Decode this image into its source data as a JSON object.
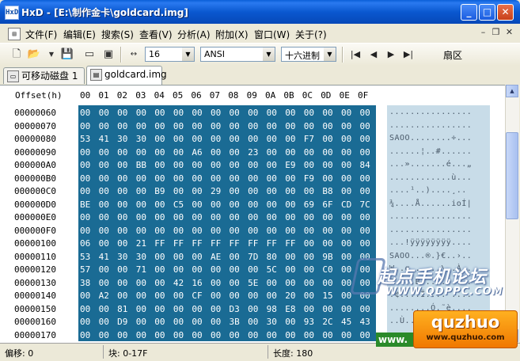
{
  "window": {
    "title": "HxD - [E:\\制作金卡\\goldcard.img]",
    "icon": "HxD"
  },
  "menu": {
    "items": [
      "文件(F)",
      "编辑(E)",
      "搜索(S)",
      "查看(V)",
      "分析(A)",
      "附加(X)",
      "窗口(W)",
      "关于(?)"
    ]
  },
  "toolbar": {
    "bytes_per_row": "16",
    "charset": "ANSI",
    "display_mode": "十六进制",
    "sector_label": "扇区"
  },
  "tabs": [
    {
      "label": "可移动磁盘 1",
      "active": false
    },
    {
      "label": "goldcard.img",
      "active": true
    }
  ],
  "hex_view": {
    "offset_header": "Offset(h)",
    "columns": [
      "00",
      "01",
      "02",
      "03",
      "04",
      "05",
      "06",
      "07",
      "08",
      "09",
      "0A",
      "0B",
      "0C",
      "0D",
      "0E",
      "0F"
    ],
    "rows": [
      {
        "offset": "00000060",
        "bytes": "00 00 00 00 00 00 00 00 00 00 00 00 00 00 00 00",
        "ascii": "................"
      },
      {
        "offset": "00000070",
        "bytes": "00 00 00 00 00 00 00 00 00 00 00 00 00 00 00 00",
        "ascii": "................"
      },
      {
        "offset": "00000080",
        "bytes": "53 41 30 30 00 00 00 00 00 00 00 00 F7 00 00 00",
        "ascii": "SAOO........÷..."
      },
      {
        "offset": "00000090",
        "bytes": "00 00 00 00 00 00 A6 00 00 23 00 00 00 00 00 00",
        "ascii": "......¦..#......"
      },
      {
        "offset": "000000A0",
        "bytes": "00 00 00 BB 00 00 00 00 00 00 00 E9 00 00 00 84",
        "ascii": "...».......é...„"
      },
      {
        "offset": "000000B0",
        "bytes": "00 00 00 00 00 00 00 00 00 00 00 00 F9 00 00 00",
        "ascii": "............ù..."
      },
      {
        "offset": "000000C0",
        "bytes": "00 00 00 00 B9 00 00 29 00 00 00 00 00 B8 00 00",
        "ascii": "....¹..)....¸.."
      },
      {
        "offset": "000000D0",
        "bytes": "BE 00 00 00 00 C5 00 00 00 00 00 00 69 6F CD 7C",
        "ascii": "¾....Å......ioÍ|"
      },
      {
        "offset": "000000E0",
        "bytes": "00 00 00 00 00 00 00 00 00 00 00 00 00 00 00 00",
        "ascii": "................"
      },
      {
        "offset": "000000F0",
        "bytes": "00 00 00 00 00 00 00 00 00 00 00 00 00 00 00 00",
        "ascii": "................"
      },
      {
        "offset": "00000100",
        "bytes": "06 00 00 21 FF FF FF FF FF FF FF FF 00 00 00 00",
        "ascii": "...!ÿÿÿÿÿÿÿÿ...."
      },
      {
        "offset": "00000110",
        "bytes": "53 41 30 30 00 00 00 AE 00 7D 80 00 00 9B 00 00",
        "ascii": "SAOO...®.}€..›.."
      },
      {
        "offset": "00000120",
        "bytes": "57 00 00 71 00 00 00 00 00 00 5C 00 00 C0 00 00",
        "ascii": "W..q......\\..À.."
      },
      {
        "offset": "00000130",
        "bytes": "38 00 00 00 00 42 16 00 00 5E 00 00 00 00 00 00",
        "ascii": "8....B...^......"
      },
      {
        "offset": "00000140",
        "bytes": "00 A2 00 00 00 00 CF 00 00 00 00 20 00 15 00 00",
        "ascii": ".¢....Ï.... ...."
      },
      {
        "offset": "00000150",
        "bytes": "00 00 81 00 00 00 00 00 D3 00 98 E8 00 00 00 00",
        "ascii": "........Ó.˜è...."
      },
      {
        "offset": "00000160",
        "bytes": "00 00 D9 00 00 00 00 00 3B 00 30 00 93 2C 45 43",
        "ascii": "..Ù.....;.0.“,EC"
      },
      {
        "offset": "00000170",
        "bytes": "00 00 00 00 00 00 00 00 00 00 00 00 00 00 00 00",
        "ascii": "................"
      }
    ]
  },
  "status": {
    "offset": "偏移: 0",
    "block": "块: 0-17F",
    "length": "长度: 180"
  },
  "watermarks": {
    "qdppc_cn": "起点手机论坛",
    "qdppc_url": "WWW.QDPPC.COM",
    "quzhuo_title": "quzhuo",
    "quzhuo_url": "www.quzhuo.com",
    "green_label": "www."
  },
  "colors": {
    "selection": "#1a6b94",
    "ascii_selection": "#c8dce8",
    "titlebar": "#0a58d0"
  }
}
